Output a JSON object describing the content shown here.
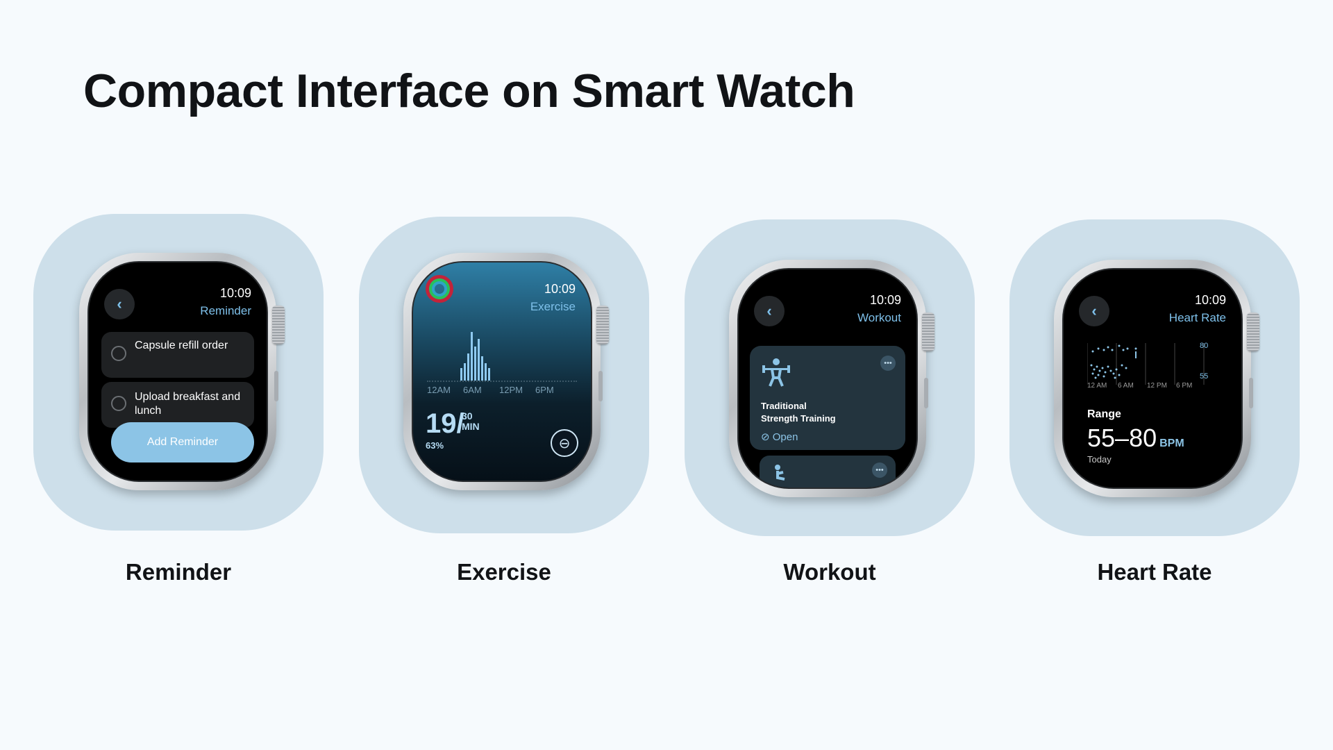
{
  "page": {
    "title": "Compact Interface on Smart Watch"
  },
  "colors": {
    "background": "#f6fafd",
    "card": "#cddfea",
    "accent": "#7ec0ea"
  },
  "reminder": {
    "label": "Reminder",
    "time": "10:09",
    "app_title": "Reminder",
    "back_icon": "chevron-left-icon",
    "items": [
      {
        "text": "Capsule refill order"
      },
      {
        "text": "Upload breakfast and lunch"
      }
    ],
    "add_button": "Add Reminder"
  },
  "exercise": {
    "label": "Exercise",
    "time": "10:09",
    "app_title": "Exercise",
    "ring_icon": "activity-rings-icon",
    "ticks": [
      "12AM",
      "6AM",
      "12PM",
      "6PM"
    ],
    "bars": [
      0.25,
      0.35,
      0.55,
      1.0,
      0.7,
      0.85,
      0.5,
      0.35,
      0.25
    ],
    "value": "19/",
    "goal_top": "30",
    "goal_bottom": "MIN",
    "percent": "63%",
    "control_icon": "minus-circle-icon"
  },
  "workout": {
    "label": "Workout",
    "time": "10:09",
    "app_title": "Workout",
    "back_icon": "chevron-left-icon",
    "card": {
      "icon": "weightlifting-icon",
      "name_line1": "Traditional",
      "name_line2": "Strength Training",
      "status": "Open",
      "more_icon": "more-icon"
    },
    "next_card_icon": "stretching-icon"
  },
  "heart_rate": {
    "label": "Heart Rate",
    "time": "10:09",
    "app_title": "Heart Rate",
    "back_icon": "chevron-left-icon",
    "ticks": [
      "12 AM",
      "6 AM",
      "12 PM",
      "6 PM"
    ],
    "y_ticks": [
      "80",
      "55"
    ],
    "range_label": "Range",
    "range_value": "55–80",
    "unit": "BPM",
    "period": "Today"
  }
}
